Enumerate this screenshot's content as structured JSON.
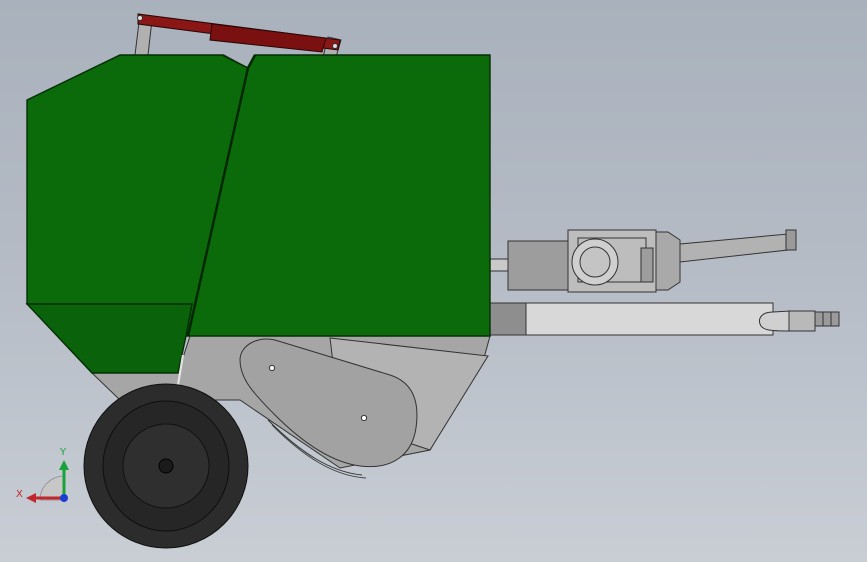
{
  "viewport": {
    "background_top": "#a9b1bc",
    "background_bottom": "#c9ced5"
  },
  "model": {
    "name": "",
    "body_color": "#0b6b0b",
    "cylinder_color": "#8a1616",
    "steel_color": "#a7a7a7",
    "tire_color": "#2b2b2b"
  },
  "triad": {
    "x_label": "X",
    "y_label": "Y",
    "x_color": "#c0282c",
    "y_color": "#18a33a",
    "z_color": "#1d3fd0"
  }
}
